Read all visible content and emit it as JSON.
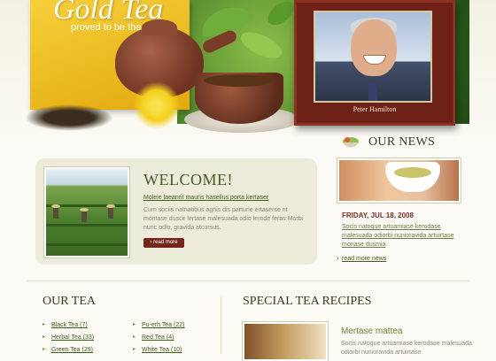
{
  "header": {
    "logo_title": "Gold Tea",
    "tagline": "proved to be the best",
    "photo_caption": "Peter Hamilton"
  },
  "welcome": {
    "heading": "WELCOME!",
    "link": "Moleie laeanrit mauris hasellus porta kertaser",
    "text": "Cum sociis natnatibus agnis dis parturie ertaserse nt montase dusce lertase malesuada odio lerode feras Morbi nunc odio, gravida atcursus.",
    "button": "› read more"
  },
  "news": {
    "heading": "OUR NEWS",
    "date": "FRIDAY, JUL 18, 2008",
    "text": "Socis natoque artuamiase kerodase malesuada odiorbi nunioravida artuirtase monase dusmia",
    "more_link": "read more news"
  },
  "our_tea": {
    "heading": "OUR TEA",
    "col1": [
      "Black Tea (7)",
      "Herbal Tea (33)",
      "Green Tea (29)"
    ],
    "col2": [
      "Pu-erh Tea (22)",
      "Red Tea (4)",
      "White Tea (10)"
    ]
  },
  "recipes": {
    "heading": "SPECIAL TEA RECIPES",
    "item_title": "Mertase mattea",
    "item_text": "Socis natoque artuamiase kerodase malesuada odiorbi nunioravida artuirtase"
  },
  "colors": {
    "brand_gold": "#f6d03a",
    "accent_brown": "#74261b",
    "link_green": "#3f5f1a"
  }
}
